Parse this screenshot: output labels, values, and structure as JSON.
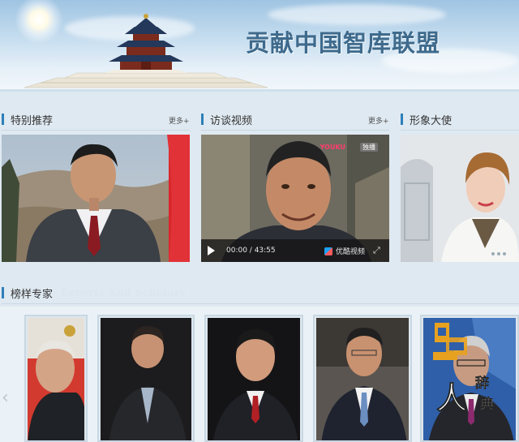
{
  "banner": {
    "title": "贡献中国智库联盟"
  },
  "sections": {
    "special": {
      "title": "特别推荐",
      "more": "更多+"
    },
    "interview": {
      "title": "访谈视频",
      "more": "更多+"
    },
    "ambassador": {
      "title": "形象大使"
    },
    "experts": {
      "title": "榜样专家",
      "subtitle": "Experts And Scholars"
    }
  },
  "video": {
    "time": "00:00 / 43:55",
    "provider": "优酷视频",
    "badge_brand": "YOUKU",
    "badge_exclusive": "独播"
  },
  "watermark": {
    "big": "人",
    "small1": "辞",
    "small2": "典"
  },
  "colors": {
    "accent": "#2e7fb8",
    "banner_title": "#3e6a8c"
  }
}
